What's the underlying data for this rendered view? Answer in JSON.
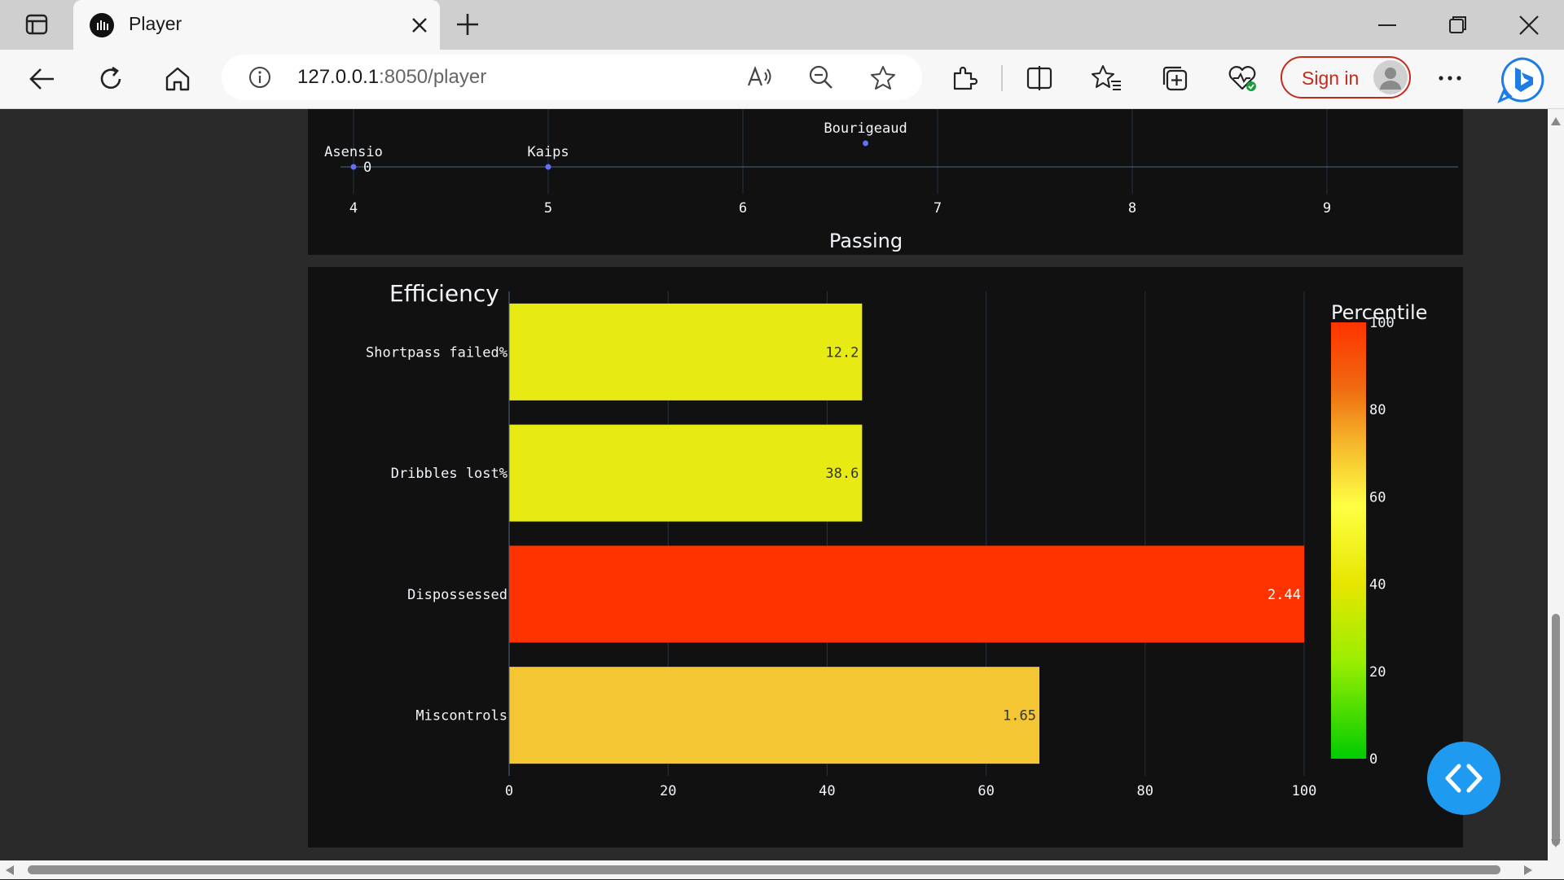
{
  "browser": {
    "tab_title": "Player",
    "url_host": "127.0.0.1",
    "url_path": ":8050/player",
    "sign_in_label": "Sign in"
  },
  "top_chart": {
    "xlabel": "Passing",
    "y_tick": "0",
    "x_ticks": [
      "4",
      "5",
      "6",
      "7",
      "8",
      "9"
    ],
    "points": [
      {
        "label": "Asensio",
        "x": 4.0,
        "y": 0
      },
      {
        "label": "Kaips",
        "x": 5.0,
        "y": 0
      },
      {
        "label": "Bourigeaud",
        "x": 6.63,
        "y": 0.5
      }
    ]
  },
  "chart_data": {
    "type": "bar",
    "title": "Efficiency",
    "categories": [
      "Shortpass failed%",
      "Dribbles lost%",
      "Dispossessed",
      "Miscontrols"
    ],
    "values": [
      44.4,
      44.4,
      100,
      66.7
    ],
    "data_labels": [
      "12.2",
      "38.6",
      "2.44",
      "1.65"
    ],
    "bar_colors": [
      "#e8eb13",
      "#e8eb13",
      "#ff3300",
      "#f5c633"
    ],
    "xlim": [
      0,
      100
    ],
    "x_ticks": [
      "0",
      "20",
      "40",
      "60",
      "80",
      "100"
    ],
    "colorbar": {
      "title": "Percentile",
      "ticks": [
        "0",
        "20",
        "40",
        "60",
        "80",
        "100"
      ],
      "range": [
        0,
        100
      ]
    }
  },
  "colors": {
    "background": "#2a2a2a",
    "card": "#111111",
    "grid": "#283442",
    "text": "#f2f5fa",
    "accent_blue": "#1e9bf0",
    "sign_in_red": "#c42b1c"
  }
}
